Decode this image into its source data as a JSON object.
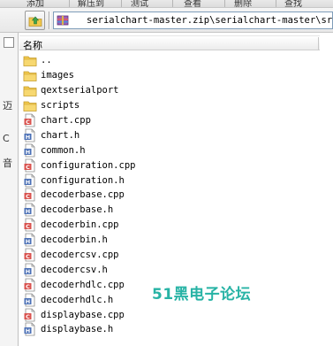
{
  "toolbar": {
    "items": [
      "添加",
      "解压到",
      "测试",
      "查看",
      "删除",
      "查找"
    ]
  },
  "address_bar": {
    "path": "serialchart-master.zip\\serialchart-master\\src"
  },
  "left_pane": {
    "fragments": [
      "迈",
      "C",
      "音"
    ]
  },
  "file_list": {
    "column_name": "名称",
    "items": [
      {
        "name": "..",
        "type": "folder"
      },
      {
        "name": "images",
        "type": "folder"
      },
      {
        "name": "qextserialport",
        "type": "folder"
      },
      {
        "name": "scripts",
        "type": "folder"
      },
      {
        "name": "chart.cpp",
        "type": "cpp"
      },
      {
        "name": "chart.h",
        "type": "h"
      },
      {
        "name": "common.h",
        "type": "h"
      },
      {
        "name": "configuration.cpp",
        "type": "cpp"
      },
      {
        "name": "configuration.h",
        "type": "h"
      },
      {
        "name": "decoderbase.cpp",
        "type": "cpp"
      },
      {
        "name": "decoderbase.h",
        "type": "h"
      },
      {
        "name": "decoderbin.cpp",
        "type": "cpp"
      },
      {
        "name": "decoderbin.h",
        "type": "h"
      },
      {
        "name": "decodercsv.cpp",
        "type": "cpp"
      },
      {
        "name": "decodercsv.h",
        "type": "h"
      },
      {
        "name": "decoderhdlc.cpp",
        "type": "cpp"
      },
      {
        "name": "decoderhdlc.h",
        "type": "h"
      },
      {
        "name": "displaybase.cpp",
        "type": "cpp"
      },
      {
        "name": "displaybase.h",
        "type": "h"
      }
    ]
  },
  "watermark": {
    "text": "51黑电子论坛"
  },
  "colors": {
    "folder": "#f2c94c",
    "cpp_badge": "#d9534f",
    "h_badge": "#4a6fb5",
    "watermark": "#27b3a5",
    "address_border": "#7f9db9"
  }
}
